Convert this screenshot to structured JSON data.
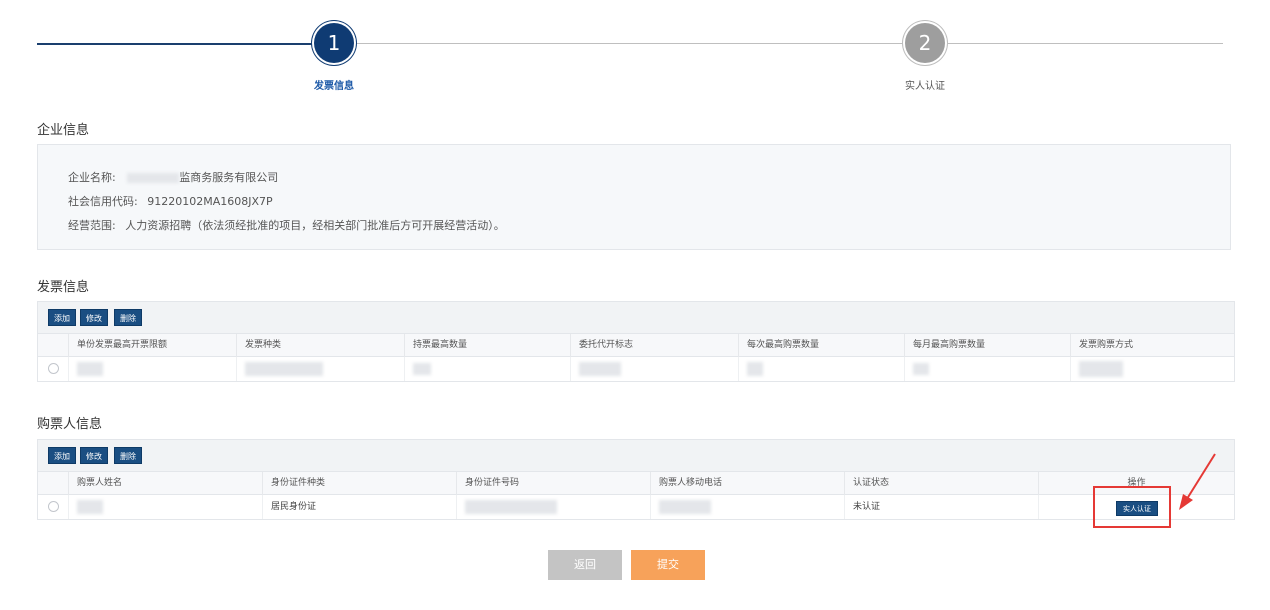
{
  "stepper": {
    "step1_number": "1",
    "step1_label": "发票信息",
    "step2_number": "2",
    "step2_label": "实人认证"
  },
  "company": {
    "section_title": "企业信息",
    "name_label": "企业名称:",
    "name_value": "监商务服务有限公司",
    "credit_label": "社会信用代码:",
    "credit_value": "91220102MA1608JX7P",
    "scope_label": "经营范围:",
    "scope_value": "人力资源招聘（依法须经批准的项目，经相关部门批准后方可开展经营活动）。"
  },
  "invoice": {
    "section_title": "发票信息",
    "add_label": "添加",
    "edit_label": "修改",
    "delete_label": "删除",
    "columns": [
      "单份发票最高开票限额",
      "发票种类",
      "持票最高数量",
      "委托代开标志",
      "每次最高购票数量",
      "每月最高购票数量",
      "发票购票方式"
    ]
  },
  "buyer": {
    "section_title": "购票人信息",
    "add_label": "添加",
    "edit_label": "修改",
    "delete_label": "删除",
    "columns": [
      "购票人姓名",
      "身份证件种类",
      "身份证件号码",
      "购票人移动电话",
      "认证状态",
      "操作"
    ],
    "row": {
      "id_type": "居民身份证",
      "status": "未认证",
      "action_label": "实人认证"
    }
  },
  "footer": {
    "back_label": "返回",
    "submit_label": "提交"
  },
  "colors": {
    "primary": "#0f3b73",
    "button": "#1a4e82",
    "submit": "#f7a25a",
    "back": "#c4c4c4",
    "annotation": "#e53935"
  }
}
